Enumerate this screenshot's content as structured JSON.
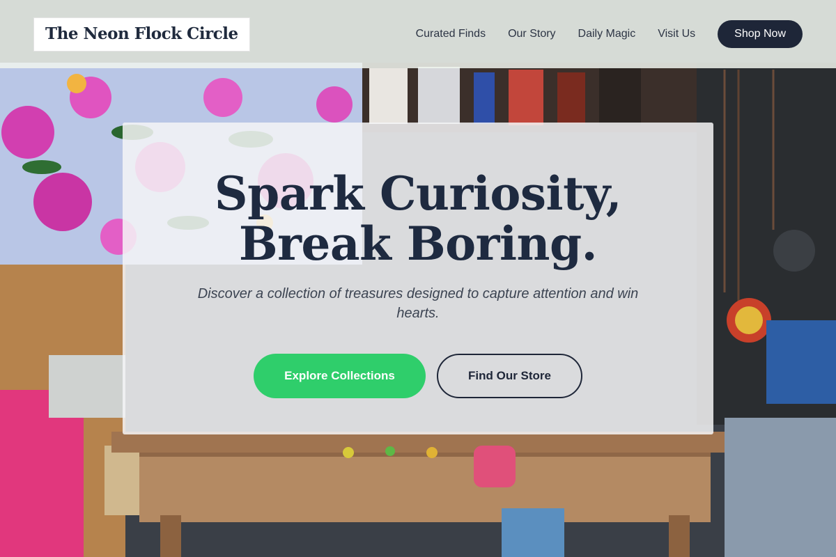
{
  "brand": {
    "name": "The Neon Flock Circle"
  },
  "nav": {
    "items": [
      {
        "label": "Curated Finds"
      },
      {
        "label": "Our Story"
      },
      {
        "label": "Daily Magic"
      },
      {
        "label": "Visit Us"
      }
    ],
    "cta_label": "Shop Now"
  },
  "hero": {
    "title_line1": "Spark Curiosity,",
    "title_line2": "Break Boring.",
    "subtitle": "Discover a collection of treasures designed to capture attention and win hearts.",
    "primary_cta": "Explore Collections",
    "secondary_cta": "Find Our Store"
  },
  "colors": {
    "navy": "#1e2638",
    "accent_green": "#2fce6b",
    "header_bg": "#f0f4ee"
  }
}
